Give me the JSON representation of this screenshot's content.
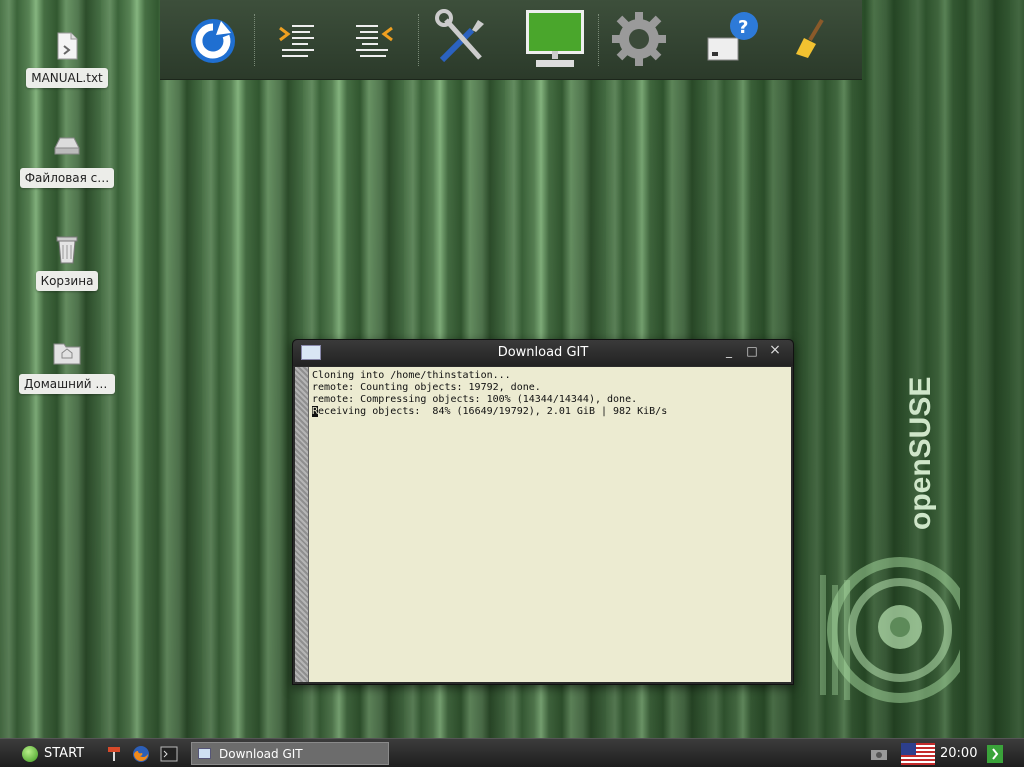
{
  "desktop": {
    "icons": [
      {
        "label": "MANUAL.txt",
        "icon": "text-file-icon"
      },
      {
        "label": "Файловая с…",
        "icon": "drive-icon"
      },
      {
        "label": "Корзина",
        "icon": "trash-icon"
      },
      {
        "label": "Домашний к…",
        "icon": "home-folder-icon"
      }
    ],
    "brand": "openSUSE"
  },
  "toolbar": {
    "buttons": [
      {
        "icon": "refresh-icon"
      },
      {
        "icon": "indent-right-icon"
      },
      {
        "icon": "indent-left-icon"
      },
      {
        "icon": "tools-icon"
      },
      {
        "icon": "monitor-icon"
      },
      {
        "icon": "gear-icon"
      },
      {
        "icon": "help-disk-icon"
      },
      {
        "icon": "broom-icon"
      }
    ]
  },
  "window": {
    "title": "Download GIT",
    "controls": {
      "minimize": "_",
      "maximize": "□",
      "close": "×"
    },
    "terminal_lines": [
      "Cloning into /home/thinstation...",
      "remote: Counting objects: 19792, done.",
      "remote: Compressing objects: 100% (14344/14344), done."
    ],
    "progress_line_first": "R",
    "progress_line_rest": "eceiving objects:  84% (16649/19792), 2.01 GiB | 982 KiB/s"
  },
  "taskbar": {
    "start_label": "START",
    "task_label": "Download GIT",
    "clock": "20:00"
  },
  "colors": {
    "toolbar_bg": "#2b3a2a",
    "terminal_bg": "#ecebd1",
    "taskbar_bg": "#1e1e1e"
  }
}
